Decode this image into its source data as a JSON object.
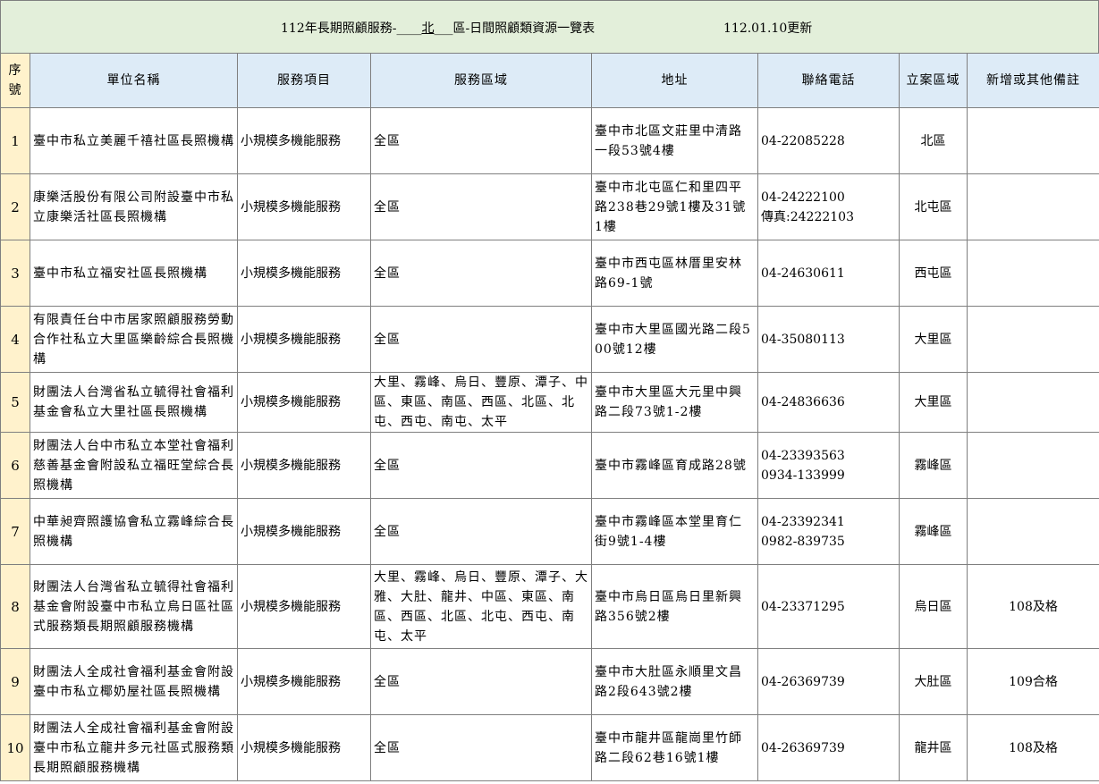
{
  "title": {
    "prefix": "112年長期照顧服務-",
    "blank_before": "____",
    "district": "北",
    "blank_after": "___",
    "suffix": "區-日間照顧類資源一覽表",
    "updated": "112.01.10更新"
  },
  "table": {
    "headers": [
      "序號",
      "單位名稱",
      "服務項目",
      "服務區域",
      "地址",
      "聯絡電話",
      "立案區域",
      "新增或其他備註"
    ],
    "rows": [
      {
        "seq": "1",
        "name": "臺中市私立美麗千禧社區長照機構",
        "service": "小規模多機能服務",
        "area": "全區",
        "address": "臺中市北區文莊里中清路一段53號4樓",
        "phone": "04-22085228",
        "registered": "北區",
        "note": ""
      },
      {
        "seq": "2",
        "name": "康樂活股份有限公司附設臺中市私立康樂活社區長照機構",
        "service": "小規模多機能服務",
        "area": "全區",
        "address": "臺中市北屯區仁和里四平路238巷29號1樓及31號1樓",
        "phone": "04-24222100\n傳真:24222103",
        "registered": "北屯區",
        "note": ""
      },
      {
        "seq": "3",
        "name": "臺中市私立福安社區長照機構",
        "service": "小規模多機能服務",
        "area": "全區",
        "address": "臺中市西屯區林厝里安林路69-1號",
        "phone": "04-24630611",
        "registered": "西屯區",
        "note": ""
      },
      {
        "seq": "4",
        "name": "有限責任台中市居家照顧服務勞動合作社私立大里區樂齡綜合長照機構",
        "service": "小規模多機能服務",
        "area": "全區",
        "address": "臺中市大里區國光路二段500號12樓",
        "phone": "04-35080113",
        "registered": "大里區",
        "note": ""
      },
      {
        "seq": "5",
        "name": "財團法人台灣省私立毓得社會福利基金會私立大里社區長照機構",
        "service": "小規模多機能服務",
        "area": "大里、霧峰、烏日、豐原、潭子、中區、東區、南區、西區、北區、北屯、西屯、南屯、太平",
        "address": "臺中市大里區大元里中興路二段73號1-2樓",
        "phone": "04-24836636",
        "registered": "大里區",
        "note": ""
      },
      {
        "seq": "6",
        "name": "財團法人台中市私立本堂社會福利慈善基金會附設私立福旺堂綜合長照機構",
        "service": "小規模多機能服務",
        "area": "全區",
        "address": "臺中市霧峰區育成路28號",
        "phone": "04-23393563\n0934-133999",
        "registered": "霧峰區",
        "note": ""
      },
      {
        "seq": "7",
        "name": "中華昶齊照護協會私立霧峰綜合長照機構",
        "service": "小規模多機能服務",
        "area": "全區",
        "address": "臺中市霧峰區本堂里育仁街9號1-4樓",
        "phone": "04-23392341\n0982-839735",
        "registered": "霧峰區",
        "note": ""
      },
      {
        "seq": "8",
        "name": "財團法人台灣省私立毓得社會福利基金會附設臺中市私立烏日區社區式服務類長期照顧服務機構",
        "service": "小規模多機能服務",
        "area": "大里、霧峰、烏日、豐原、潭子、大雅、大肚、龍井、中區、東區、南區、西區、北區、北屯、西屯、南屯、太平",
        "address": "臺中市烏日區烏日里新興路356號2樓",
        "phone": "04-23371295",
        "registered": "烏日區",
        "note": "108及格"
      },
      {
        "seq": "9",
        "name": "財團法人全成社會福利基金會附設臺中市私立椰奶屋社區長照機構",
        "service": "小規模多機能服務",
        "area": "全區",
        "address": "臺中市大肚區永順里文昌路2段643號2樓",
        "phone": "04-26369739",
        "registered": "大肚區",
        "note": "109合格"
      },
      {
        "seq": "10",
        "name": "財團法人全成社會福利基金會附設臺中市私立龍井多元社區式服務類長期照顧服務機構",
        "service": "小規模多機能服務",
        "area": "全區",
        "address": "臺中市龍井區龍崗里竹師路二段62巷16號1樓",
        "phone": "04-26369739",
        "registered": "龍井區",
        "note": "108及格"
      }
    ]
  }
}
